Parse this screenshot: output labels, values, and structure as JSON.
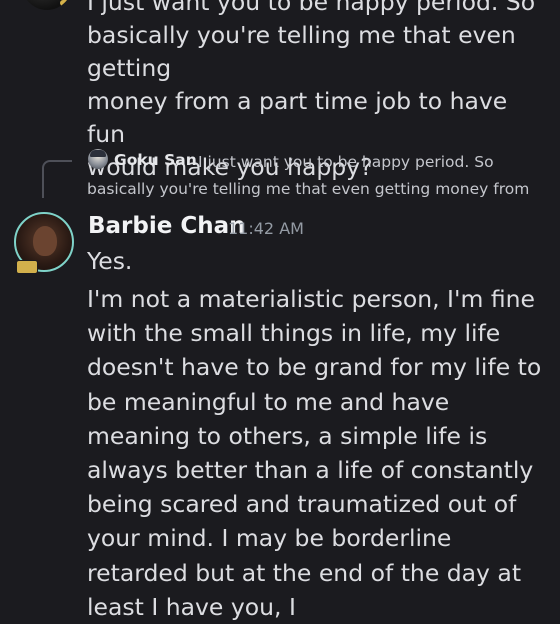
{
  "previous_message": {
    "text": "I just want you to be happy period. So\nbasically you're telling me that even getting\nmoney from a part time job to have fun\nwould make you happy?"
  },
  "reply": {
    "author": "Goku San",
    "preview": "I just want you to be happy period. So basically you're telling me that even getting money from"
  },
  "message": {
    "author": "Barbie Chan",
    "timestamp": "11:42 AM",
    "first_line": "Yes.",
    "body": "I'm not a materialistic person, I'm fine with the small things in life, my life doesn't have to be grand for my life to be meaningful to me and have meaning to others, a simple life is always better than a life of constantly being scared and traumatized out of your mind. I may be borderline retarded but at the end of the day at least I have you, I"
  },
  "colors": {
    "background": "#1b1b1f",
    "text": "#dcdde1",
    "timestamp": "#949ba4",
    "avatar_ring": "#7fd3c9"
  }
}
